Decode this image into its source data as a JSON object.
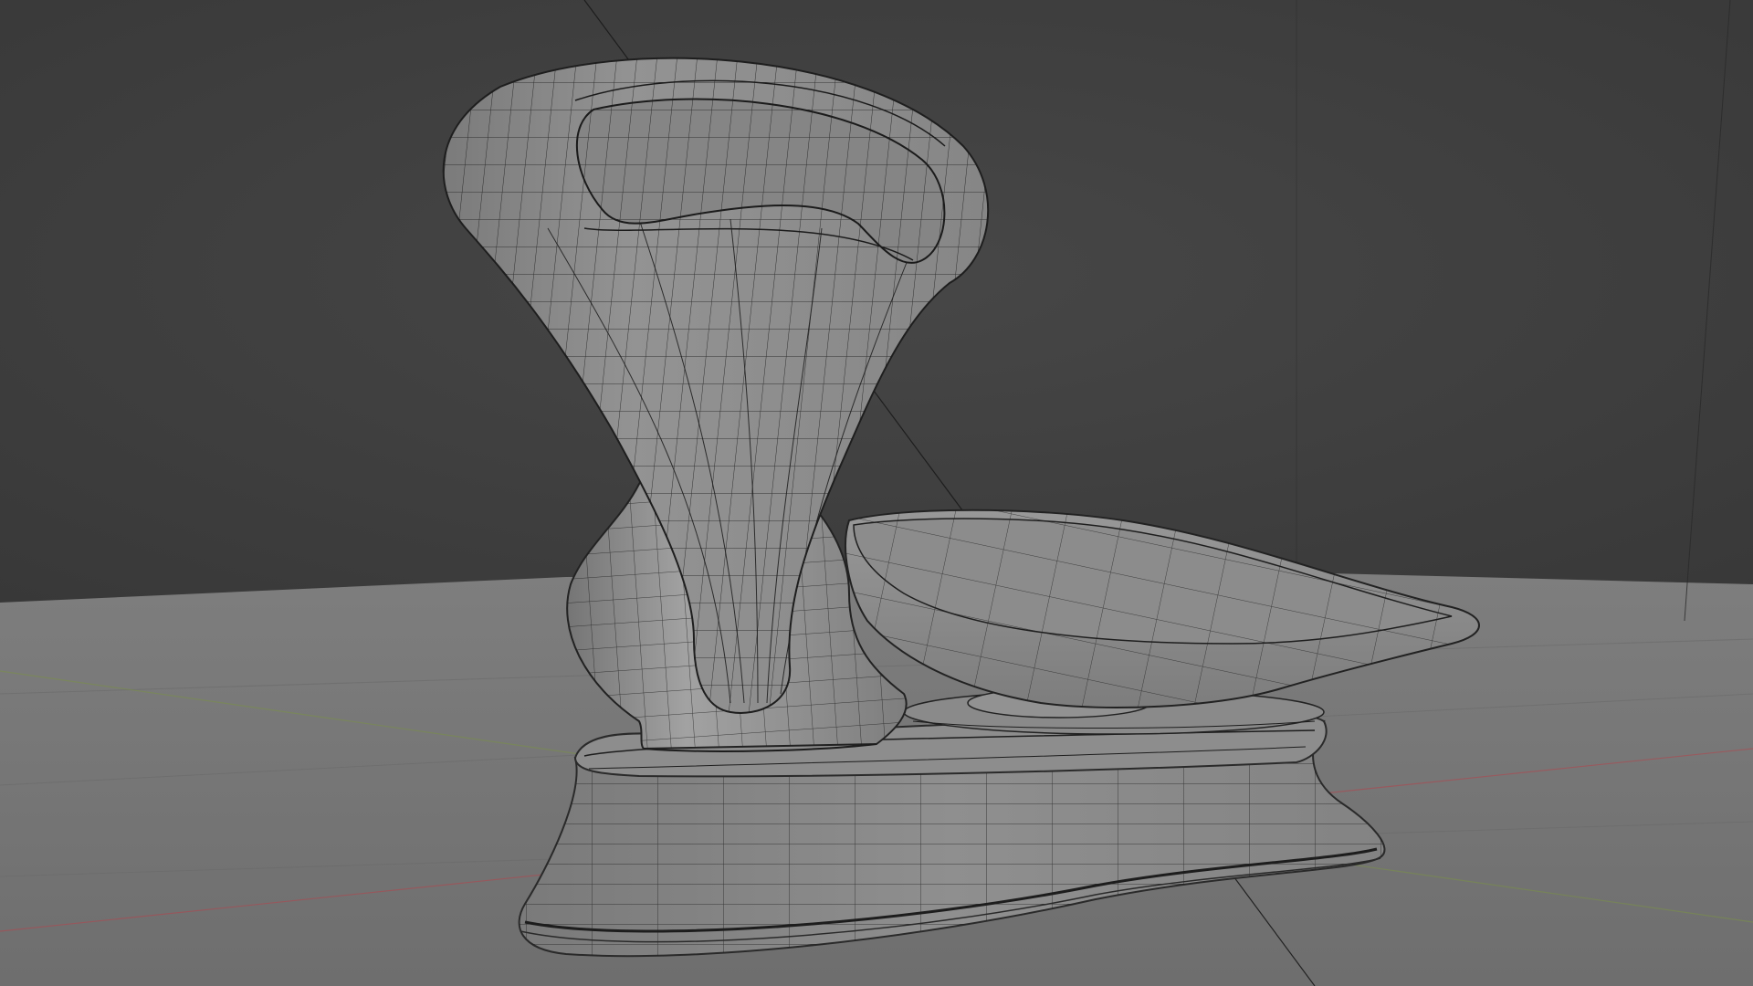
{
  "viewport": {
    "view_mode": "3D viewport",
    "shading": "solid",
    "overlay": "wireframe",
    "background_color": "#3d3d3d",
    "floor_color": "#777777",
    "mesh_color": "#8a8a8a",
    "wire_color": "#1c1c1c",
    "axis_x_color": "#b0474f",
    "axis_y_color": "#7a8f4a"
  },
  "scene": {
    "object": "antique-kitchen-scale",
    "parts": [
      "dial-face",
      "dial-window",
      "neck-column",
      "pan",
      "pan-pedestal",
      "base"
    ]
  }
}
